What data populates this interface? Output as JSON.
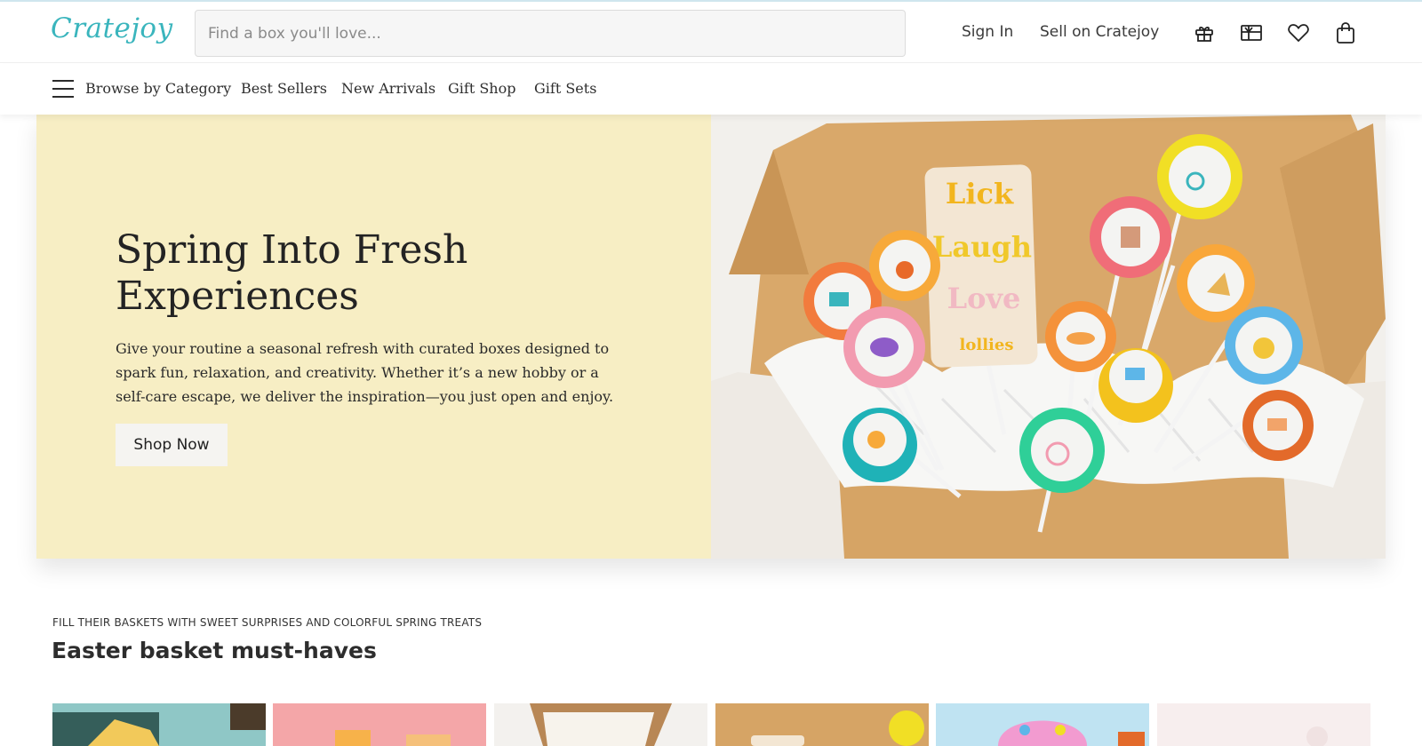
{
  "header": {
    "logo": "Cratejoy",
    "search_placeholder": "Find a box you'll love...",
    "sign_in": "Sign In",
    "sell": "Sell on Cratejoy",
    "icons": [
      "gift-icon",
      "gift-card-icon",
      "heart-icon",
      "bag-icon"
    ]
  },
  "nav": {
    "browse": "Browse by Category",
    "items": [
      "Best Sellers",
      "New Arrivals",
      "Gift Shop",
      "Gift Sets"
    ]
  },
  "hero": {
    "title": "Spring Into Fresh Experiences",
    "text": "Give your routine a seasonal refresh with curated boxes designed to spark fun, relaxation, and creativity. Whether it’s a new hobby or a self-care escape, we deliver the inspiration—you just open and enjoy.",
    "cta": "Shop Now",
    "card_lines": [
      "Lick",
      "Laugh",
      "Love"
    ],
    "card_brand": "lollies",
    "colors": {
      "background": "#f7eec4",
      "accent": "#3ab5bd"
    }
  },
  "section": {
    "eyebrow": "FILL THEIR BASKETS WITH SWEET SURPRISES AND COLORFUL SPRING TREATS",
    "title": "Easter basket must-haves"
  }
}
